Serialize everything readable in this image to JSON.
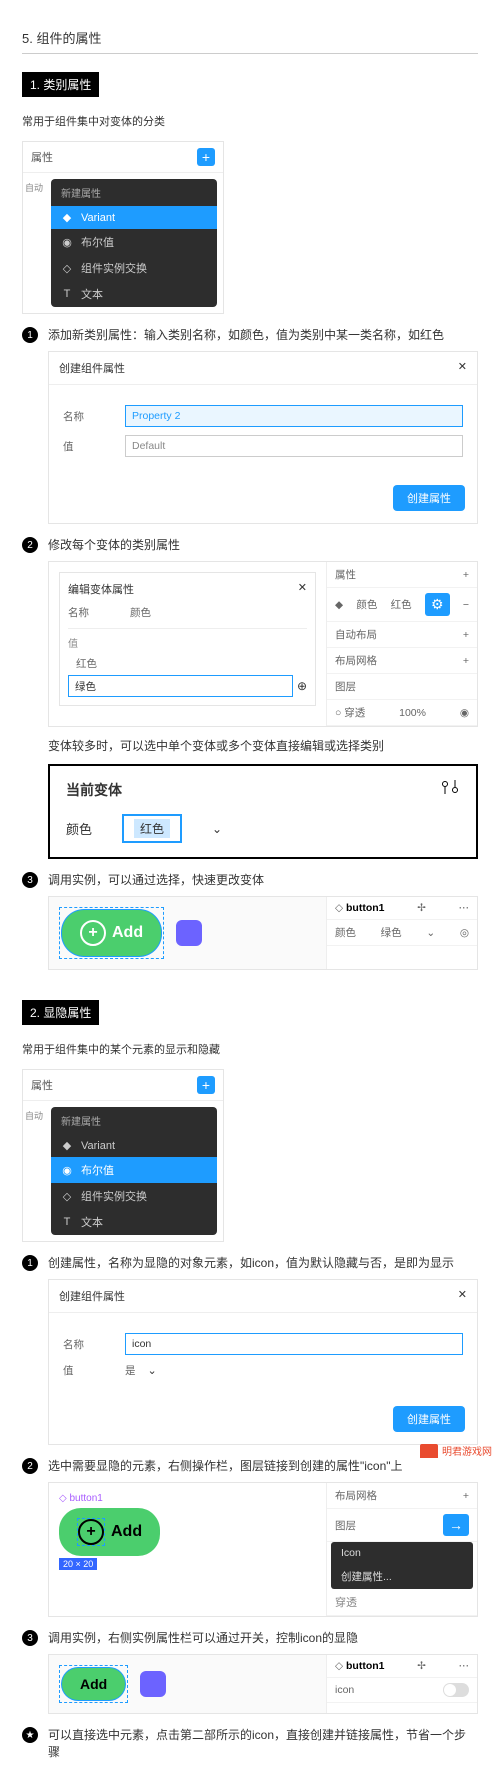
{
  "heading": "5. 组件的属性",
  "section1": {
    "title": "1. 类别属性",
    "intro": "常用于组件集中对变体的分类",
    "properties_panel_title": "属性",
    "side_label": "自动",
    "menu": {
      "header": "新建属性",
      "variant": "Variant",
      "boolean": "布尔值",
      "swap": "组件实例交换",
      "text": "文本"
    },
    "step1": {
      "text": "添加新类别属性：输入类别名称，如颜色，值为类别中某一类名称，如红色",
      "dialog_title": "创建组件属性",
      "name_label": "名称",
      "name_value": "Property 2",
      "value_label": "值",
      "value_value": "Default",
      "button": "创建属性"
    },
    "step2": {
      "text": "修改每个变体的类别属性",
      "edit_title": "编辑变体属性",
      "name_label": "名称",
      "name_value": "颜色",
      "value_label": "值",
      "red": "红色",
      "green_input": "绿色",
      "side": {
        "props": "属性",
        "color": "颜色",
        "color_val": "红色",
        "autolayout": "自动布局",
        "grid": "布局网格",
        "layers": "图层",
        "pass": "穿透",
        "pct": "100%"
      },
      "note": "变体较多时，可以选中单个变体或多个变体直接编辑或选择类别",
      "current_variant": "当前变体",
      "color_label": "颜色",
      "selected": "红色"
    },
    "step3": {
      "text": "调用实例，可以通过选择，快速更改变体",
      "add": "Add",
      "button1": "button1",
      "color": "颜色",
      "color_val": "绿色"
    }
  },
  "section2": {
    "title": "2. 显隐属性",
    "intro": "常用于组件集中的某个元素的显示和隐藏",
    "step1": {
      "text": "创建属性，名称为显隐的对象元素，如icon，值为默认隐藏与否，是即为显示",
      "dialog_title": "创建组件属性",
      "name_label": "名称",
      "name_value": "icon",
      "value_label": "值",
      "value_value": "是",
      "button": "创建属性"
    },
    "step2": {
      "text": "选中需要显隐的元素，右侧操作栏，图层链接到创建的属性\"icon\"上",
      "button1": "button1",
      "add": "Add",
      "size": "20 × 20",
      "grid": "布局网格",
      "layers": "图层",
      "pass": "穿透",
      "icon_opt": "Icon",
      "create_opt": "创建属性..."
    },
    "step3": {
      "text": "调用实例，右侧实例属性栏可以通过开关，控制icon的显隐",
      "button1": "button1",
      "add": "Add",
      "icon_label": "icon"
    },
    "star_note": "可以直接选中元素，点击第二部所示的icon，直接创建并链接属性，节省一个步骤"
  },
  "logo_text": "明君游戏网"
}
